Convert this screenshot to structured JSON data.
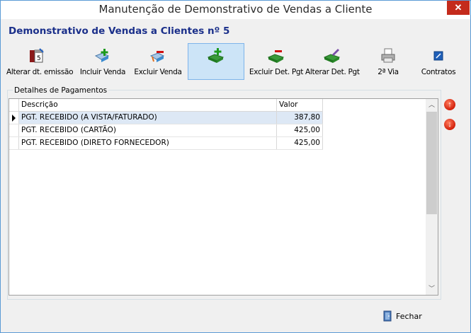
{
  "window": {
    "title": "Manutenção de Demonstrativo de Vendas a Cliente",
    "close_glyph": "✕"
  },
  "header": {
    "title": "Demonstrativo de Vendas a Clientes nº  5"
  },
  "toolbar": {
    "buttons": [
      {
        "label": "Alterar dt. emissão",
        "icon": "calendar-edit-icon"
      },
      {
        "label": "Incluir Venda",
        "icon": "add-sale-icon"
      },
      {
        "label": "Excluir Venda",
        "icon": "remove-sale-icon"
      },
      {
        "label": "",
        "icon": "add-payment-icon"
      },
      {
        "label": "Excluir Det. Pgt",
        "icon": "remove-payment-icon"
      },
      {
        "label": "Alterar Det. Pgt",
        "icon": "edit-payment-icon"
      },
      {
        "label": "2ª Via",
        "icon": "printer-icon"
      },
      {
        "label": "Contratos",
        "icon": "contracts-icon"
      }
    ]
  },
  "payments": {
    "group_label": "Detalhes de Pagamentos",
    "columns": [
      "Descrição",
      "Valor"
    ],
    "rows": [
      {
        "descricao": "PGT. RECEBIDO (A VISTA/FATURADO)",
        "valor": "387,80"
      },
      {
        "descricao": "PGT. RECEBIDO (CARTÃO)",
        "valor": "425,00"
      },
      {
        "descricao": "PGT. RECEBIDO (DIRETO FORNECEDOR)",
        "valor": "425,00"
      }
    ],
    "selected_row": 0
  },
  "scroll": {
    "up_glyph": "︿",
    "down_glyph": "﹀"
  },
  "side_buttons": {
    "up_glyph": "↑",
    "down_glyph": "↓"
  },
  "footer": {
    "close_label": "Fechar"
  },
  "colors": {
    "header_title": "#1a2f8a",
    "selected_row": "#dde8f5",
    "active_button": "#cce4f7",
    "close_red": "#c42b1c"
  }
}
